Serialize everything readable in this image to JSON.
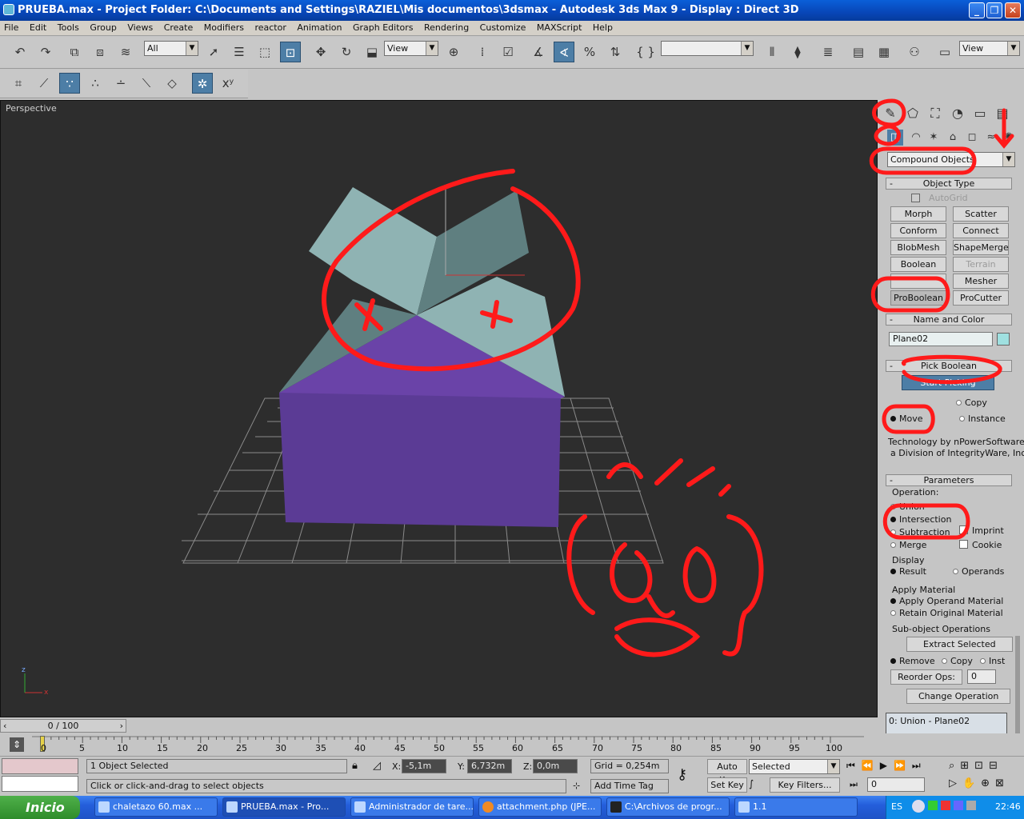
{
  "window": {
    "title": "PRUEBA.max     - Project Folder: C:\\Documents and Settings\\RAZIEL\\Mis documentos\\3dsmax     - Autodesk 3ds Max 9     - Display : Direct 3D"
  },
  "menu": [
    "File",
    "Edit",
    "Tools",
    "Group",
    "Views",
    "Create",
    "Modifiers",
    "reactor",
    "Animation",
    "Graph Editors",
    "Rendering",
    "Customize",
    "MAXScript",
    "Help"
  ],
  "toolbar": {
    "selection_filter": "All",
    "ref_coord": "View",
    "named_selection": "",
    "view_drop_right": "View"
  },
  "viewport": {
    "label": "Perspective",
    "colors": {
      "box": "#5b3b95",
      "box_top": "#6a43a8",
      "roof_light": "#8fb3b3",
      "roof_dark": "#5f7f80",
      "grid": "#8a8a8a",
      "bg": "#2d2d2d"
    }
  },
  "panel": {
    "category": "Compound Objects",
    "object_type": {
      "header": "Object Type",
      "autogrid": "AutoGrid",
      "buttons": [
        "Morph",
        "Scatter",
        "Conform",
        "Connect",
        "BlobMesh",
        "ShapeMerge",
        "Boolean",
        "Terrain",
        "",
        "Mesher",
        "ProBoolean",
        "ProCutter"
      ]
    },
    "name_color": {
      "header": "Name and Color",
      "name": "Plane02",
      "color": "#9fe0e0"
    },
    "pick_boolean": {
      "header": "Pick Boolean",
      "start_picking": "Start Picking",
      "copy": "Copy",
      "move": "Move",
      "instance": "Instance",
      "credit1": "Technology by nPowerSoftware",
      "credit2": "a Division of IntegrityWare, Inc."
    },
    "parameters": {
      "header": "Parameters",
      "operation_label": "Operation:",
      "union": "Union",
      "intersection": "Intersection",
      "subtraction": "Subtraction",
      "merge": "Merge",
      "imprint": "Imprint",
      "cookie": "Cookie",
      "display_label": "Display",
      "result": "Result",
      "operands": "Operands",
      "apply_material_label": "Apply Material",
      "apply_operand": "Apply Operand Material",
      "retain_original": "Retain Original Material",
      "subobject_label": "Sub-object Operations",
      "extract_selected": "Extract Selected",
      "remove": "Remove",
      "copy": "Copy",
      "inst": "Inst",
      "reorder_ops": "Reorder Ops:",
      "reorder_value": "0",
      "change_operation": "Change Operation",
      "list_item": "0: Union - Plane02"
    }
  },
  "timeline": {
    "slider": "0 / 100",
    "ticks": [
      "0",
      "5",
      "10",
      "15",
      "20",
      "25",
      "30",
      "35",
      "40",
      "45",
      "50",
      "55",
      "60",
      "65",
      "70",
      "75",
      "80",
      "85",
      "90",
      "95",
      "100"
    ]
  },
  "status": {
    "selected": "1 Object Selected",
    "prompt": "Click or click-and-drag to select objects",
    "x_label": "X:",
    "x": "-5,1m",
    "y_label": "Y:",
    "y": "6,732m",
    "z_label": "Z:",
    "z": "0,0m",
    "grid": "Grid = 0,254m",
    "add_time_tag": "Add Time Tag",
    "auto_key": "Auto Key",
    "set_key": "Set Key",
    "selected_drop": "Selected",
    "key_filters": "Key Filters...",
    "frame": "0"
  },
  "taskbar": {
    "start": "Inicio",
    "tasks": [
      "chaletazo 60.max     ...",
      "PRUEBA.max     - Pro...",
      "Administrador de tare...",
      "attachment.php (JPE...",
      "C:\\Archivos de progr...",
      "1.1"
    ],
    "lang": "ES",
    "clock": "22:46"
  }
}
